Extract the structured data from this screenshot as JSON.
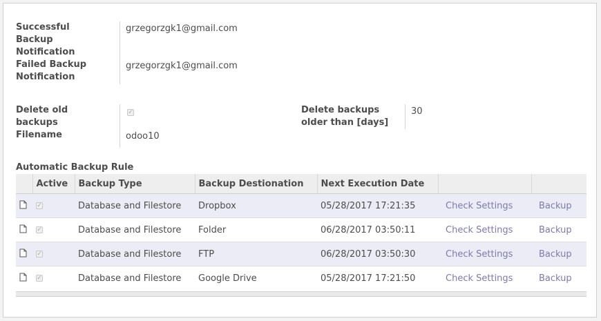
{
  "form": {
    "success_label": [
      "Successful",
      "Backup",
      "Notification"
    ],
    "success_value": "grzegorzgk1@gmail.com",
    "failed_label": [
      "Failed Backup",
      "Notification"
    ],
    "failed_value": "grzegorzgk1@gmail.com",
    "delete_old_label": [
      "Delete old",
      "backups"
    ],
    "delete_old_checked": true,
    "filename_label": "Filename",
    "filename_value": "odoo10",
    "delete_days_label": [
      "Delete backups",
      "older than [days]"
    ],
    "delete_days_value": "30"
  },
  "rules": {
    "title": "Automatic Backup Rule",
    "columns": [
      "",
      "Active",
      "Backup Type",
      "Backup Destionation",
      "Next Execution Date",
      "",
      ""
    ],
    "rows": [
      {
        "active": true,
        "type": "Database and Filestore",
        "destination": "Dropbox",
        "next": "05/28/2017 17:21:35",
        "check": "Check Settings",
        "backup": "Backup"
      },
      {
        "active": true,
        "type": "Database and Filestore",
        "destination": "Folder",
        "next": "06/28/2017 03:50:11",
        "check": "Check Settings",
        "backup": "Backup"
      },
      {
        "active": true,
        "type": "Database and Filestore",
        "destination": "FTP",
        "next": "06/28/2017 03:50:30",
        "check": "Check Settings",
        "backup": "Backup"
      },
      {
        "active": true,
        "type": "Database and Filestore",
        "destination": "Google Drive",
        "next": "05/28/2017 17:21:50",
        "check": "Check Settings",
        "backup": "Backup"
      }
    ]
  },
  "colors": {
    "link": "#7c7bad",
    "row_shade": "#ececf6",
    "header_bg": "#eeeeee"
  }
}
